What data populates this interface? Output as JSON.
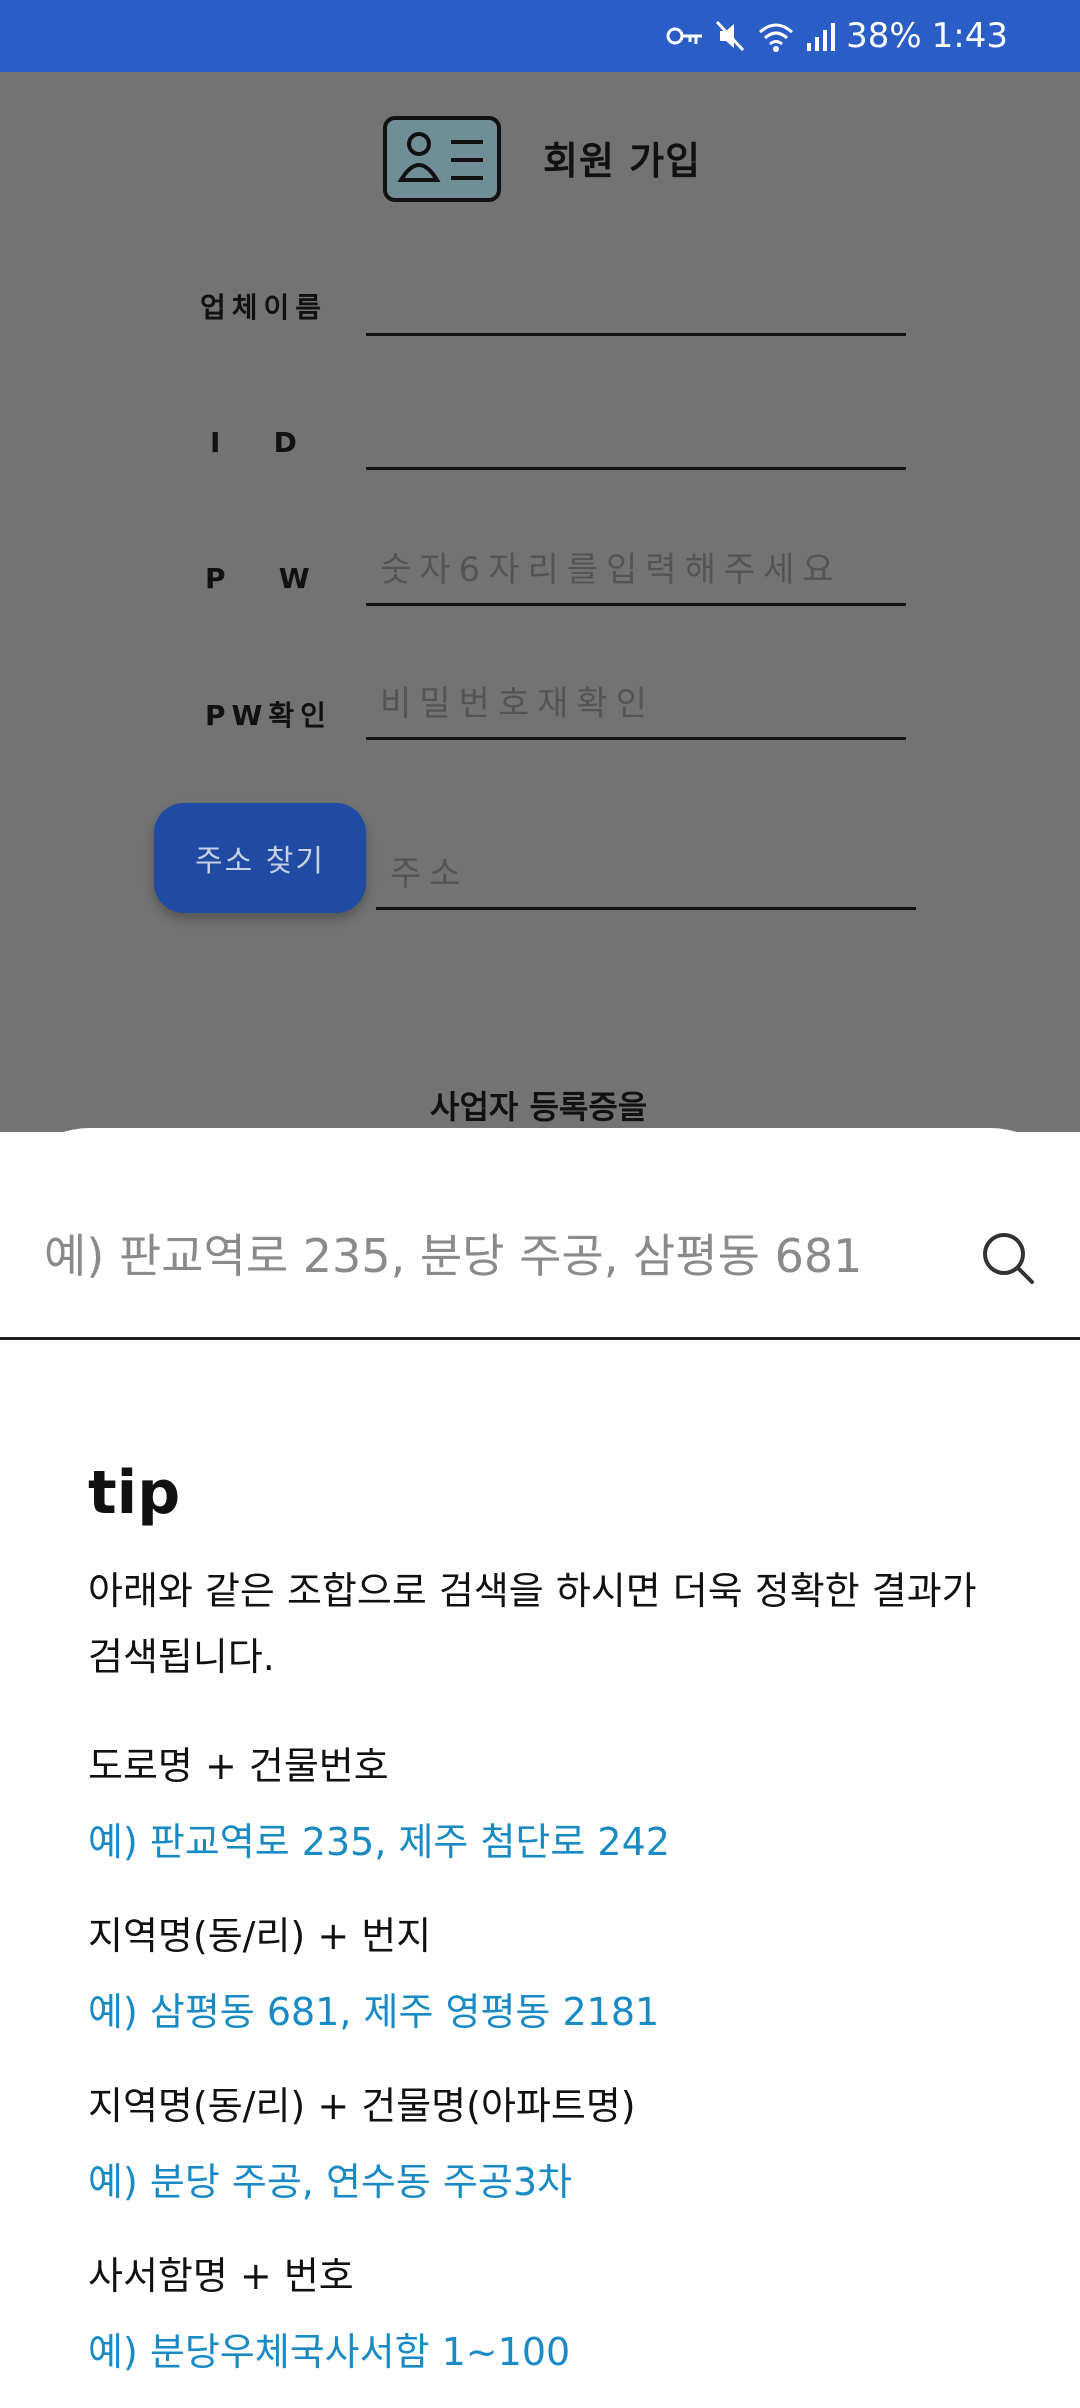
{
  "status_bar": {
    "battery": "38%",
    "time": "1:43"
  },
  "form": {
    "title": "회원 가입",
    "fields": [
      {
        "label": "업체이름",
        "placeholder": ""
      },
      {
        "label": "I   D",
        "placeholder": ""
      },
      {
        "label": "P   W",
        "placeholder": "숫자6자리를입력해주세요"
      },
      {
        "label": "PW확인",
        "placeholder": "비밀번호재확인"
      }
    ],
    "address_button": "주소 찾기",
    "address_placeholder": "주소",
    "business_note": "사업자 등록증을"
  },
  "sheet": {
    "search_placeholder": "예) 판교역로 235, 분당 주공, 삼평동 681",
    "tip_title": "tip",
    "tip_description": "아래와 같은 조합으로 검색을 하시면 더욱 정확한 결과가 검색됩니다.",
    "tips": [
      {
        "head": "도로명 + 건물번호",
        "example": "예) 판교역로 235,  제주 첨단로 242"
      },
      {
        "head": "지역명(동/리) + 번지",
        "example": "예) 삼평동 681,  제주 영평동 2181"
      },
      {
        "head": "지역명(동/리) + 건물명(아파트명)",
        "example": "예) 분당 주공,  연수동 주공3차"
      },
      {
        "head": "사서함명 + 번호",
        "example": "예) 분당우체국사서함 1~100"
      }
    ]
  },
  "colors": {
    "status_bar": "#2a5dc6",
    "overlay": "#737373",
    "button": "#1f4ba3",
    "example_text": "#1a8ac4"
  }
}
